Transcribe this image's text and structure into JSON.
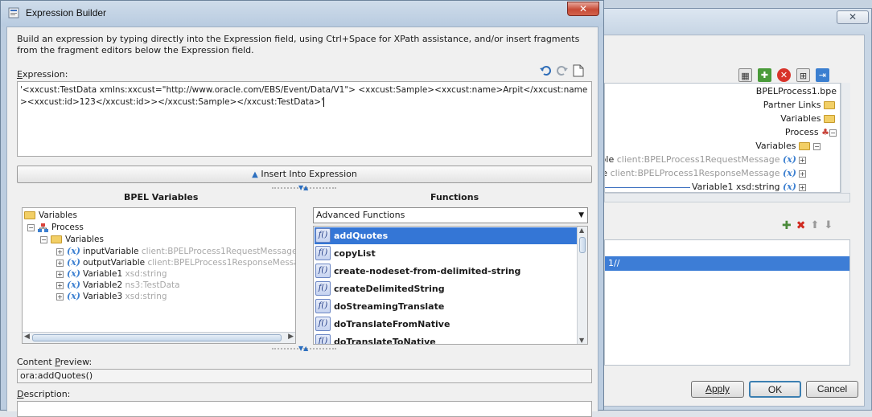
{
  "window": {
    "title": "Expression Builder",
    "close_symbol": "✕"
  },
  "instructions": "Build an expression by typing directly into the Expression field, using Ctrl+Space for XPath assistance, and/or insert fragments from the fragment editors below the Expression field.",
  "expression": {
    "label_pre": "",
    "label_mnemonic": "E",
    "label_post": "xpression:",
    "value": "'<xxcust:TestData xmlns:xxcust=\"http://www.oracle.com/EBS/Event/Data/V1\"> <xxcust:Sample><xxcust:name>Arpit</xxcust:name><xxcust:id>123</xxcust:id>></xxcust:Sample></xxcust:TestData>'",
    "tools": [
      "undo-icon",
      "redo-icon",
      "clear-icon"
    ]
  },
  "insert_button": "Insert Into Expression",
  "bpel_variables": {
    "heading": "BPEL Variables",
    "tree": [
      {
        "label": "Variables",
        "type": "",
        "icon": "folder-icon",
        "level": 0,
        "expander": ""
      },
      {
        "label": "Process",
        "type": "",
        "icon": "process-icon",
        "level": 1,
        "expander": "−"
      },
      {
        "label": "Variables",
        "type": "",
        "icon": "folder-icon",
        "level": 2,
        "expander": "−"
      },
      {
        "label": "inputVariable",
        "type": "client:BPELProcess1RequestMessage",
        "icon": "variable-icon",
        "level": 3,
        "expander": "+"
      },
      {
        "label": "outputVariable",
        "type": "client:BPELProcess1ResponseMessage",
        "icon": "variable-icon",
        "level": 3,
        "expander": "+"
      },
      {
        "label": "Variable1",
        "type": "xsd:string",
        "icon": "variable-icon",
        "level": 3,
        "expander": "+"
      },
      {
        "label": "Variable2",
        "type": "ns3:TestData",
        "icon": "variable-icon",
        "level": 3,
        "expander": "+"
      },
      {
        "label": "Variable3",
        "type": "xsd:string",
        "icon": "variable-icon",
        "level": 3,
        "expander": "+"
      }
    ]
  },
  "functions": {
    "heading": "Functions",
    "category": "Advanced Functions",
    "selected": "addQuotes",
    "items": [
      "addQuotes",
      "copyList",
      "create-nodeset-from-delimited-string",
      "createDelimitedString",
      "doStreamingTranslate",
      "doTranslateFromNative",
      "doTranslateToNative"
    ]
  },
  "content_preview": {
    "label_pre": "Content ",
    "label_mnemonic": "P",
    "label_post": "review:",
    "value": "ora:addQuotes()"
  },
  "description": {
    "label_pre": "",
    "label_mnemonic": "D",
    "label_post": "escription:",
    "value": ""
  },
  "background_dialog": {
    "close_symbol": "✕",
    "toolbar_icons": [
      "calculator-icon",
      "puzzle-icon",
      "delete-red-icon",
      "properties-icon",
      "xpath-icon"
    ],
    "tree": [
      {
        "label": "BPELProcess1.bpe",
        "type": ""
      },
      {
        "label": "Partner Links",
        "type": ""
      },
      {
        "label": "Variables",
        "type": ""
      },
      {
        "label": "Process",
        "type": ""
      },
      {
        "label": "Variables",
        "type": ""
      },
      {
        "label": "Variable",
        "type": "client:BPELProcess1RequestMessage"
      },
      {
        "label": "ariable",
        "type": "client:BPELProcess1ResponseMessage"
      },
      {
        "label": "Variable1 xsd:string",
        "type": ""
      }
    ],
    "list_tools": [
      "add-icon",
      "delete-icon",
      "move-up-icon",
      "move-down-icon"
    ],
    "list_selected": "1//",
    "buttons": {
      "apply": "Apply",
      "ok": "OK",
      "cancel": "Cancel"
    }
  }
}
